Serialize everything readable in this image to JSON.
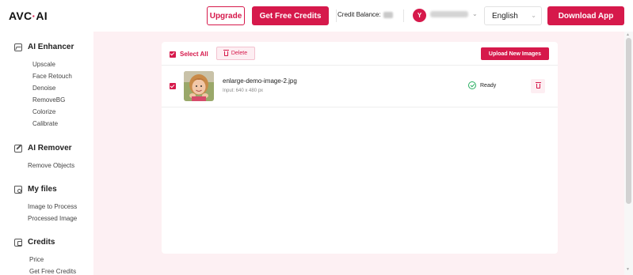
{
  "header": {
    "logo_text": "AVC",
    "logo_dot": "·",
    "logo_suffix": "AI",
    "upgrade_label": "Upgrade",
    "free_credits_label": "Get Free Credits",
    "credit_balance_label": "Credit Balance:",
    "avatar_initial": "Y",
    "language": "English",
    "download_label": "Download App"
  },
  "sidebar": {
    "sections": [
      {
        "title": "AI Enhancer",
        "icon": "image-icon",
        "items": [
          "Upscale",
          "Face Retouch",
          "Denoise",
          "RemoveBG",
          "Colorize",
          "Calibrate"
        ]
      },
      {
        "title": "AI Remover",
        "icon": "edit-icon",
        "items": [
          "Remove Objects"
        ]
      },
      {
        "title": "My files",
        "icon": "folder-icon",
        "items": [
          "Image to Process",
          "Processed Image"
        ]
      },
      {
        "title": "Credits",
        "icon": "wallet-icon",
        "items": [
          "Price",
          "Get Free Credits"
        ]
      }
    ]
  },
  "toolbar": {
    "select_all_label": "Select All",
    "delete_label": "Delete",
    "upload_label": "Upload New Images"
  },
  "files": [
    {
      "name": "enlarge-demo-image-2.jpg",
      "meta": "Input: 640 x 480 px",
      "status": "Ready"
    }
  ],
  "colors": {
    "accent": "#d6194b",
    "main_background": "#fdf0f3",
    "ready_status": "#27ae60"
  }
}
